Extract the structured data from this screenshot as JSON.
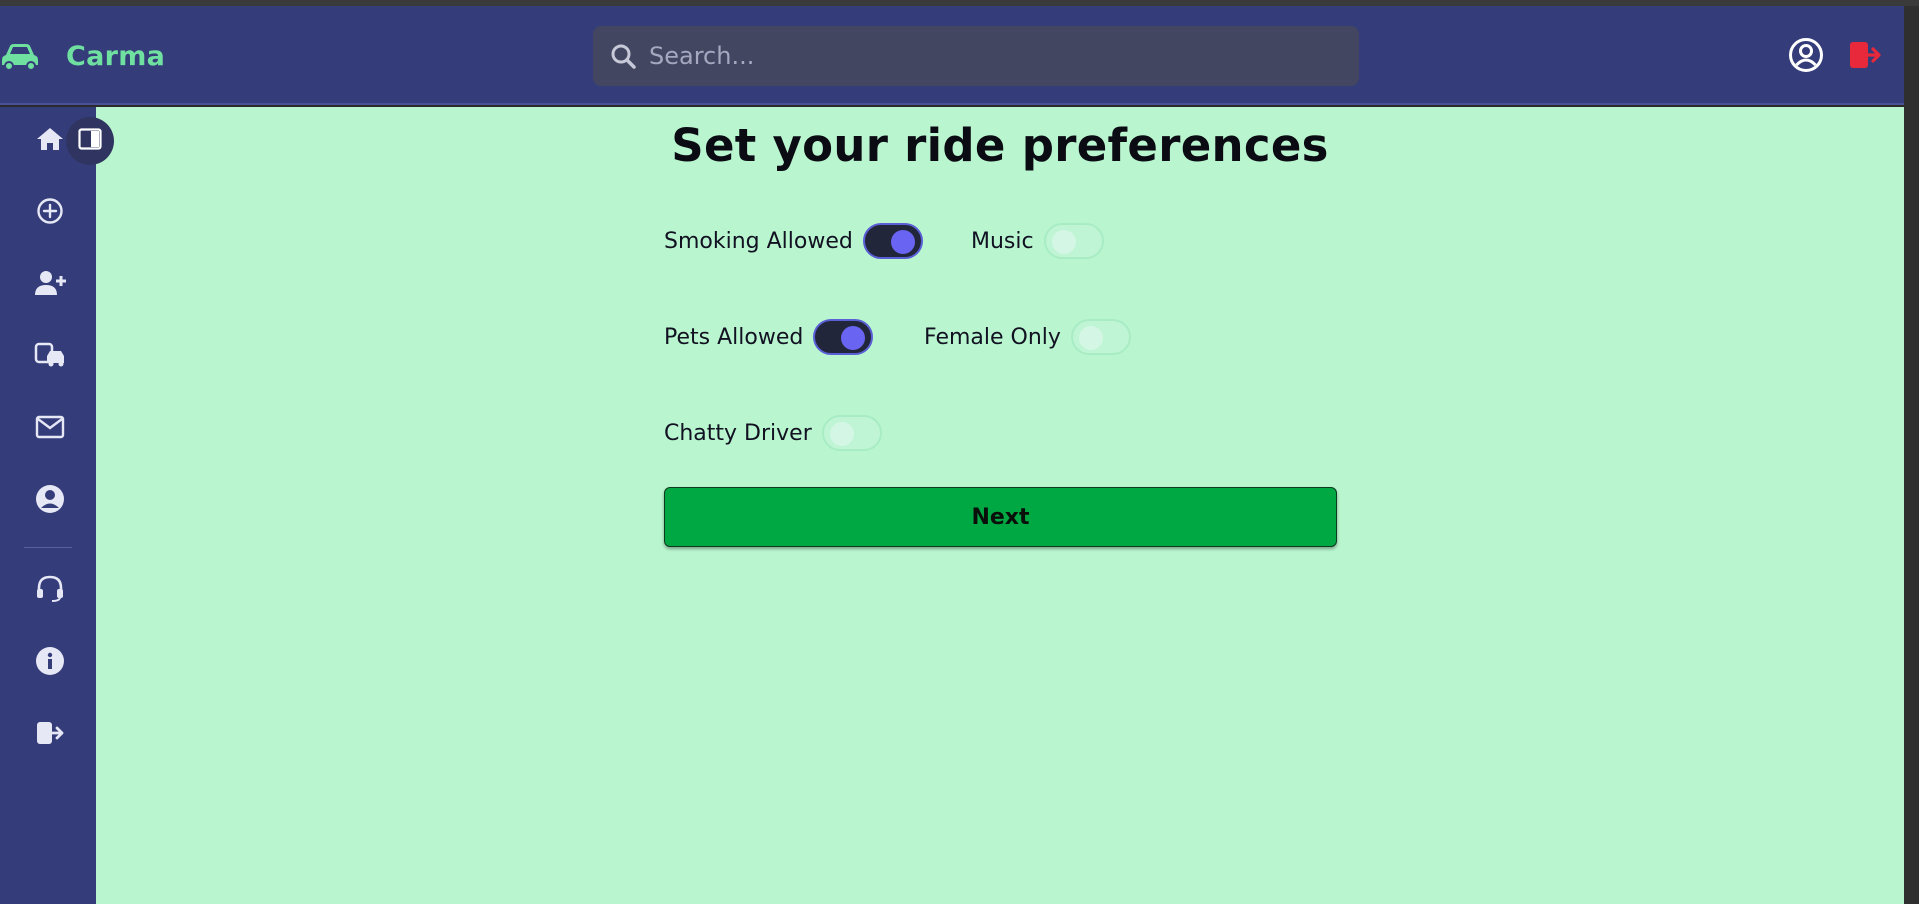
{
  "header": {
    "brand_name": "Carma",
    "search_placeholder": "Search...",
    "icons": {
      "brand": "car-icon",
      "search": "search-icon",
      "profile": "user-circle-icon",
      "logout": "logout-icon"
    }
  },
  "sidebar": {
    "items": [
      {
        "name": "home",
        "icon": "home-icon"
      },
      {
        "name": "add",
        "icon": "plus-circle-icon"
      },
      {
        "name": "add-user",
        "icon": "user-plus-icon"
      },
      {
        "name": "rides",
        "icon": "vehicles-icon"
      },
      {
        "name": "messages",
        "icon": "mail-icon"
      },
      {
        "name": "profile",
        "icon": "user-icon"
      },
      {
        "name": "support",
        "icon": "headset-icon"
      },
      {
        "name": "info",
        "icon": "info-icon"
      },
      {
        "name": "logout",
        "icon": "logout-icon"
      }
    ],
    "collapse_icon": "sidebar-toggle-icon"
  },
  "main": {
    "title": "Set your ride preferences",
    "preferences": [
      {
        "label": "Smoking Allowed",
        "enabled": true
      },
      {
        "label": "Music",
        "enabled": false
      },
      {
        "label": "Pets Allowed",
        "enabled": true
      },
      {
        "label": "Female Only",
        "enabled": false
      },
      {
        "label": "Chatty Driver",
        "enabled": false
      }
    ],
    "next_label": "Next"
  },
  "colors": {
    "header_bg": "#343c7a",
    "main_bg": "#b9f6cf",
    "brand": "#6fe0a0",
    "toggle_on": "#6a64f2",
    "next_button": "#00a844",
    "logout_accent": "#e8293b"
  }
}
